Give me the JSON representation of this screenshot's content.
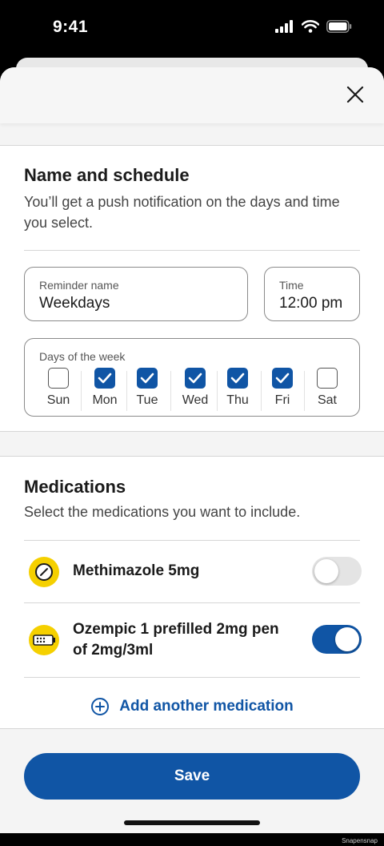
{
  "status_bar": {
    "time": "9:41"
  },
  "sheet": {
    "close_icon": "close-icon"
  },
  "schedule": {
    "title": "Name and schedule",
    "subtitle": "You’ll get a push notification on the days and time you select.",
    "reminder_name": {
      "label": "Reminder name",
      "value": "Weekdays"
    },
    "time": {
      "label": "Time",
      "value": "12:00 pm"
    },
    "days_label": "Days of the week",
    "days": [
      {
        "label": "Sun",
        "checked": false
      },
      {
        "label": "Mon",
        "checked": true
      },
      {
        "label": "Tue",
        "checked": true
      },
      {
        "label": "Wed",
        "checked": true
      },
      {
        "label": "Thu",
        "checked": true
      },
      {
        "label": "Fri",
        "checked": true
      },
      {
        "label": "Sat",
        "checked": false
      }
    ]
  },
  "medications": {
    "title": "Medications",
    "subtitle": "Select the medications you want to include.",
    "items": [
      {
        "name": "Methimazole 5mg",
        "icon": "pill-icon",
        "enabled": false
      },
      {
        "name": "Ozempic 1 prefilled 2mg pen of 2mg/3ml",
        "icon": "pen-injector-icon",
        "enabled": true
      }
    ],
    "add_label": "Add another medication"
  },
  "actions": {
    "save_label": "Save"
  },
  "watermark": "Snapensnap",
  "colors": {
    "accent": "#1055a5",
    "med_icon": "#f5d000"
  }
}
